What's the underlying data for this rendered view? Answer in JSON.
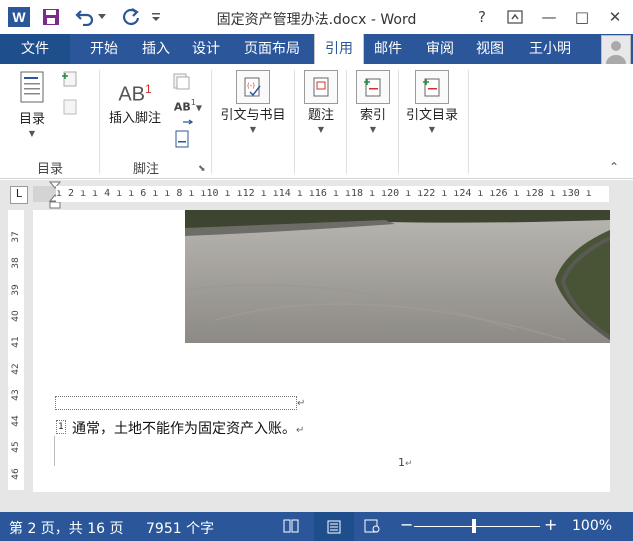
{
  "window": {
    "title": "固定资产管理办法.docx - Word",
    "logo_letter": "W",
    "help": "?",
    "restore_ribbon": "⊡",
    "minimize": "—",
    "maximize": "□",
    "close": "✕"
  },
  "tabs": [
    {
      "label": "文件"
    },
    {
      "label": "开始"
    },
    {
      "label": "插入"
    },
    {
      "label": "设计"
    },
    {
      "label": "页面布局"
    },
    {
      "label": "引用"
    },
    {
      "label": "邮件"
    },
    {
      "label": "审阅"
    },
    {
      "label": "视图"
    },
    {
      "label": "王小明"
    }
  ],
  "ribbon": {
    "toc": {
      "label": "目录",
      "group": "目录"
    },
    "insert_footnote": {
      "label": "插入脚注",
      "icon_text": "AB",
      "sup": "1"
    },
    "footnote_group": "脚注",
    "citations": {
      "label": "引文与书目"
    },
    "captions": {
      "label": "题注"
    },
    "index": {
      "label": "索引"
    },
    "toa": {
      "label": "引文目录"
    },
    "small_ab": "AB"
  },
  "ruler": {
    "corner": "L",
    "marks": "ı 2 ı   ı 4 ı   ı 6 ı   ı 8 ı   ı10 ı   ı12 ı   ı14 ı   ı16 ı   ı18 ı   ı20 ı   ı22 ı   ı24 ı   ı26 ı   ı28 ı   ı30 ı",
    "vmarks": [
      "37",
      "38",
      "39",
      "40",
      "41",
      "42",
      "43",
      "44",
      "45",
      "46"
    ]
  },
  "document": {
    "footnote_text": "通常，土地不能作为固定资产入账。",
    "footnote_mark": "1",
    "para_mark": "↵"
  },
  "status": {
    "page": "第 2 页，共 16 页",
    "words": "7951 个字",
    "zoom": "100%",
    "zoom_minus": "−",
    "zoom_plus": "+"
  },
  "colors": {
    "accent": "#2b579a",
    "accent_dark": "#1f4e8c"
  }
}
